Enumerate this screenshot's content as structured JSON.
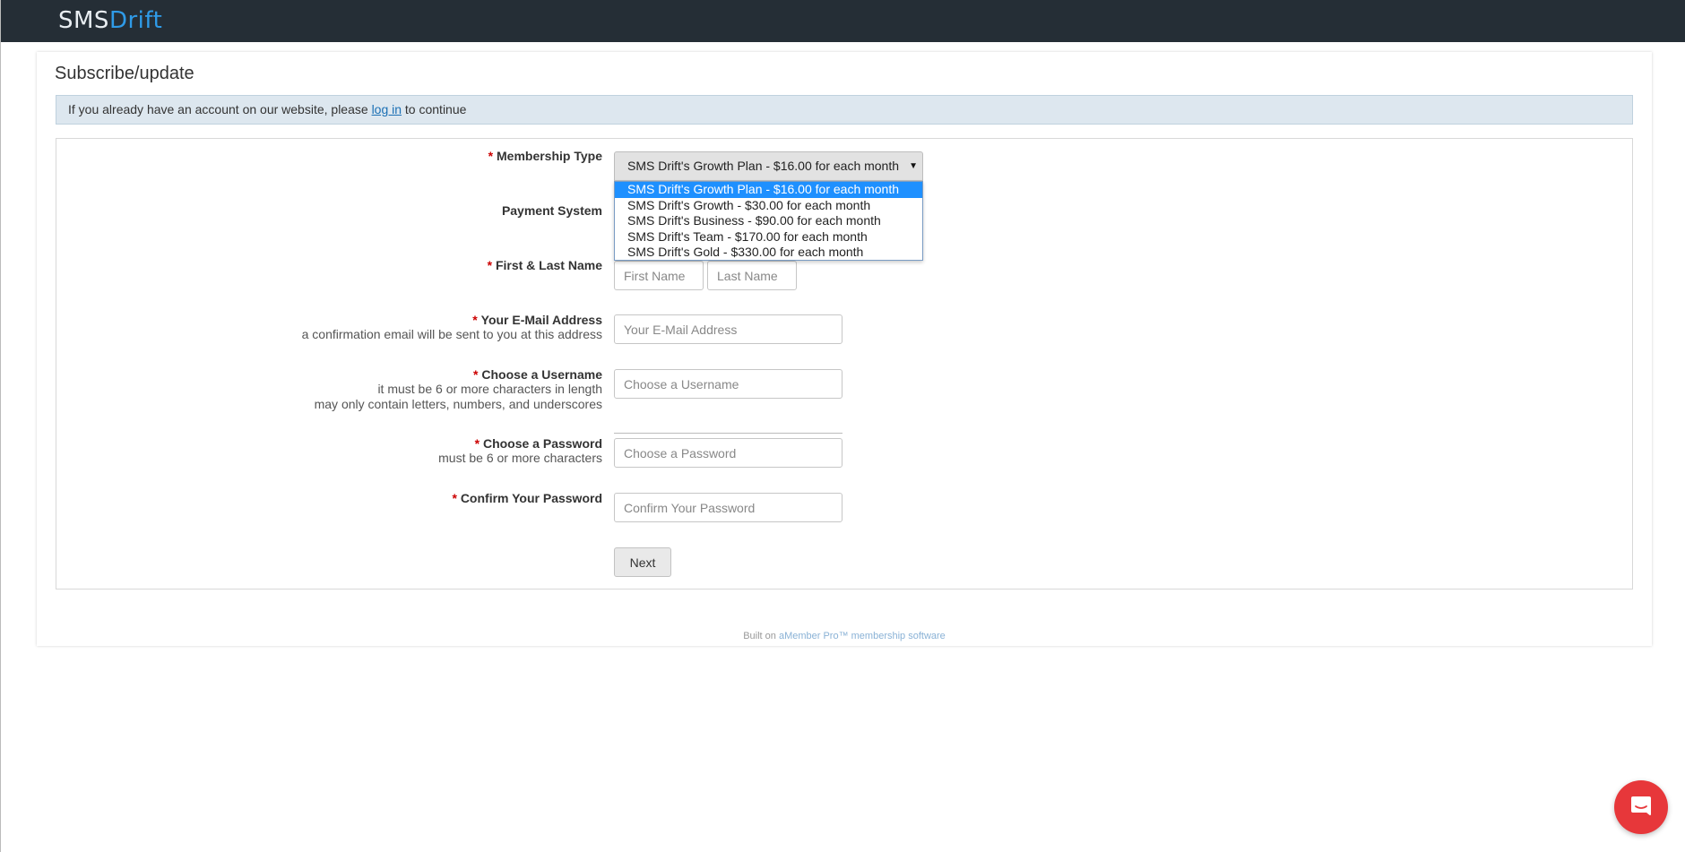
{
  "header": {
    "logo_part1": "SMS",
    "logo_part2": "Drift"
  },
  "page": {
    "title": "Subscribe/update"
  },
  "alert": {
    "before": "If you already have an account on our website, please ",
    "link": "log in",
    "after": " to continue"
  },
  "form": {
    "membership": {
      "required": "*",
      "label": "Membership Type",
      "selected": "SMS Drift's Growth Plan - $16.00 for each month",
      "options": [
        "SMS Drift's Growth Plan - $16.00 for each month",
        "SMS Drift's Growth - $30.00 for each month",
        "SMS Drift's Business - $90.00 for each month",
        "SMS Drift's Team - $170.00 for each month",
        "SMS Drift's Gold - $330.00 for each month"
      ]
    },
    "payment": {
      "label": "Payment System"
    },
    "name": {
      "required": "*",
      "label": "First & Last Name",
      "first_placeholder": "First Name",
      "last_placeholder": "Last Name"
    },
    "email": {
      "required": "*",
      "label": "Your E-Mail Address",
      "desc": "a confirmation email will be sent to you at this address",
      "placeholder": "Your E-Mail Address"
    },
    "username": {
      "required": "*",
      "label": "Choose a Username",
      "desc1": "it must be 6 or more characters in length",
      "desc2": "may only contain letters, numbers, and underscores",
      "placeholder": "Choose a Username"
    },
    "password": {
      "required": "*",
      "label": "Choose a Password",
      "desc": "must be 6 or more characters",
      "placeholder": "Choose a Password"
    },
    "confirm": {
      "required": "*",
      "label": "Confirm Your Password",
      "placeholder": "Confirm Your Password"
    },
    "submit_label": "Next"
  },
  "footer": {
    "prefix": "Built on ",
    "link": "aMember Pro™ membership software"
  },
  "chat": {
    "icon": "chat-icon",
    "color": "#e7373a"
  }
}
